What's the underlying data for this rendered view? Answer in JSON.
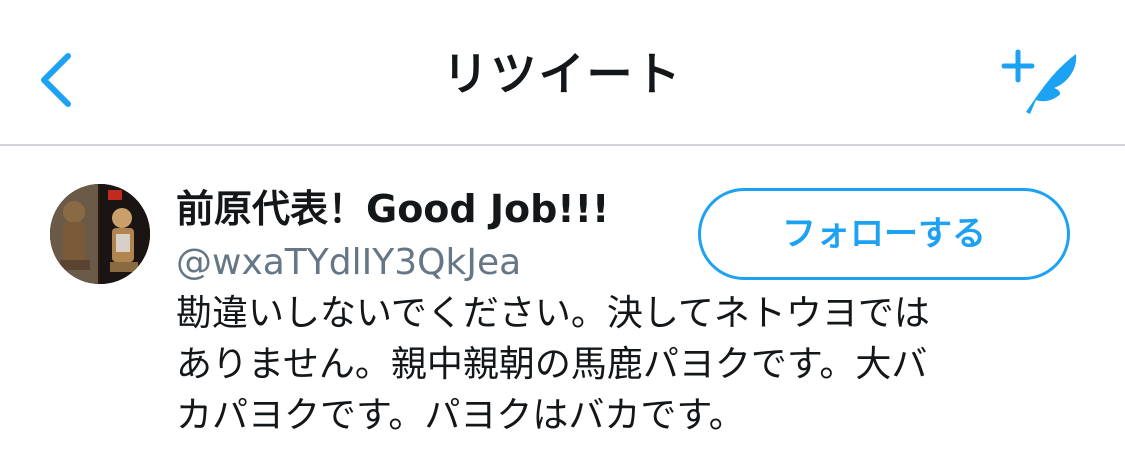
{
  "nav": {
    "title": "リツイート",
    "back_icon": "chevron-left-icon",
    "compose_icon": "compose-tweet-icon"
  },
  "user": {
    "display_name": "前原代表！Good Job!!!",
    "handle": "@wxaTYdlIY3QkJea",
    "follow_label": "フォローする",
    "bio": "勘違いしないでください。決してネトウヨでは\nありません。親中親朝の馬鹿パヨクです。大バ\nカパヨクです。パヨクはバカです。"
  },
  "colors": {
    "accent": "#1da1f2",
    "secondary_text": "#657786",
    "primary_text": "#14171a",
    "divider": "#d0d4d8"
  }
}
